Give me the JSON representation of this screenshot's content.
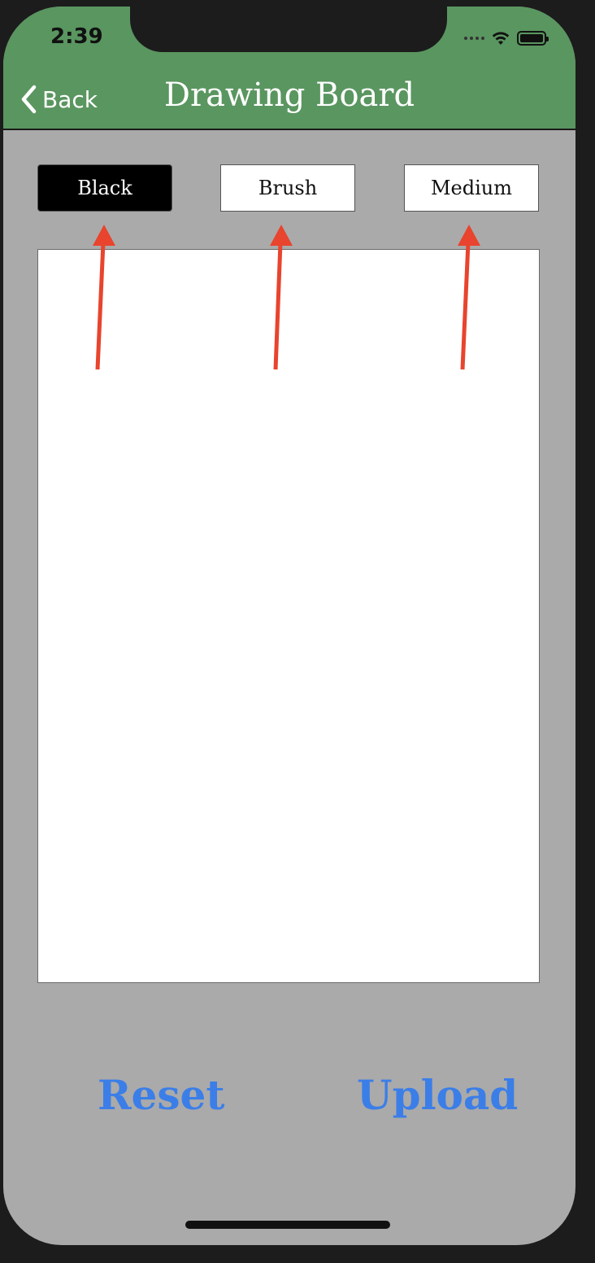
{
  "status_bar": {
    "time": "2:39"
  },
  "navbar": {
    "back_label": "Back",
    "title": "Drawing Board"
  },
  "toolbar": {
    "color_label": "Black",
    "tool_label": "Brush",
    "size_label": "Medium"
  },
  "actions": {
    "reset_label": "Reset",
    "upload_label": "Upload"
  },
  "colors": {
    "navbar": "#5a9660",
    "background": "#aaaaaa",
    "action_text": "#3b7ee8",
    "annotation_arrow": "#e8442e"
  }
}
